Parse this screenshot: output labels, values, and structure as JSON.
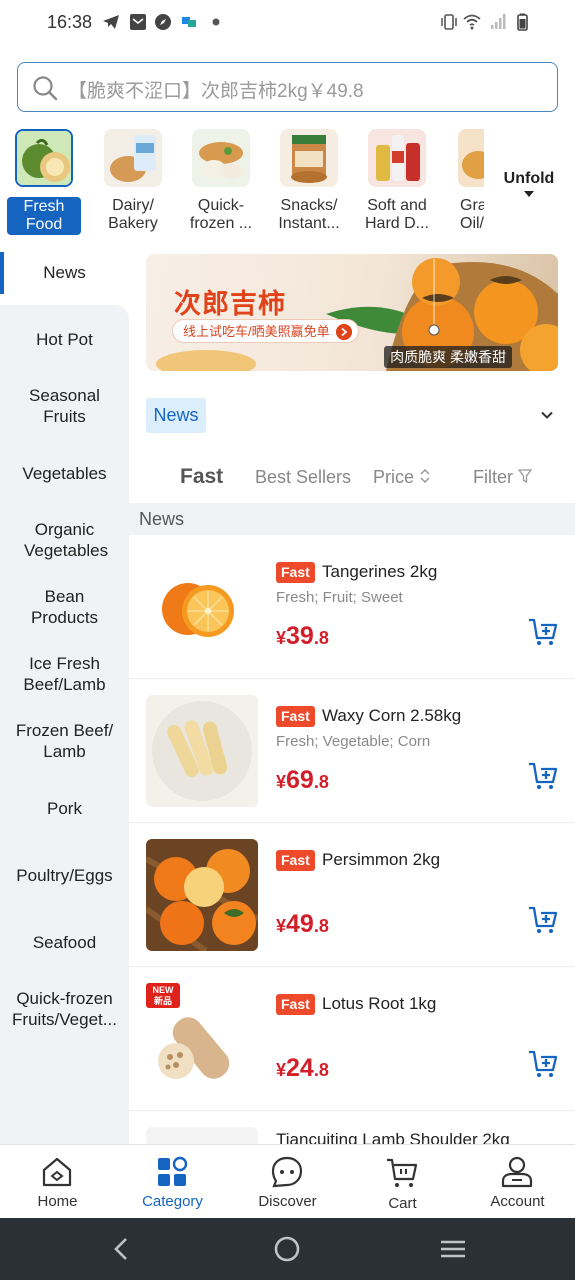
{
  "status_bar": {
    "time": "16:38",
    "icons": [
      "telegram-icon",
      "mail-icon",
      "compass-icon",
      "app-icon",
      "dot-icon",
      "vibrate-icon",
      "wifi-icon",
      "signal-icon",
      "battery-icon"
    ]
  },
  "search": {
    "placeholder": "【脆爽不涩口】次郎吉柿2kg￥49.8"
  },
  "categories": [
    {
      "label": "Fresh Food",
      "active": true
    },
    {
      "label": "Dairy/ Bakery",
      "active": false
    },
    {
      "label": "Quick- frozen ...",
      "active": false
    },
    {
      "label": "Snacks/ Instant...",
      "active": false
    },
    {
      "label": "Soft and Hard D...",
      "active": false
    },
    {
      "label": "Gra Oil/",
      "active": false
    }
  ],
  "unfold_label": "Unfold",
  "sidebar": {
    "items": [
      "News",
      "Hot Pot",
      "Seasonal Fruits",
      "Vegetables",
      "Organic Vegetables",
      "Bean Products",
      "Ice Fresh Beef/Lamb",
      "Frozen Beef/ Lamb",
      "Pork",
      "Poultry/Eggs",
      "Seafood",
      "Quick-frozen Fruits/Veget..."
    ],
    "active": "News"
  },
  "banner": {
    "title": "次郎吉柿",
    "pill": "线上试吃车/晒美照赢免单",
    "caption": "肉质脆爽 柔嫩香甜"
  },
  "filter_chip": "News",
  "sort_tabs": {
    "fast": "Fast",
    "best_sellers": "Best Sellers",
    "price": "Price",
    "filter": "Filter"
  },
  "section_title": "News",
  "products": [
    {
      "tag": "Fast",
      "name": "Tangerines 2kg",
      "desc": "Fresh; Fruit; Sweet",
      "yen": "¥",
      "price_int": "39",
      "price_dec": ".8"
    },
    {
      "tag": "Fast",
      "name": "Waxy Corn 2.58kg",
      "desc": "Fresh; Vegetable; Corn",
      "yen": "¥",
      "price_int": "69",
      "price_dec": ".8"
    },
    {
      "tag": "Fast",
      "name": "Persimmon 2kg",
      "desc": "",
      "yen": "¥",
      "price_int": "49",
      "price_dec": ".8"
    },
    {
      "tag": "Fast",
      "name": "Lotus Root 1kg",
      "desc": "",
      "yen": "¥",
      "price_int": "24",
      "price_dec": ".8",
      "badge": "NEW 新品"
    }
  ],
  "partial_product": "Tiancuiting Lamb Shoulder 2kg",
  "bottom_nav": [
    {
      "label": "Home",
      "icon": "home-icon",
      "active": false
    },
    {
      "label": "Category",
      "icon": "category-icon",
      "active": true
    },
    {
      "label": "Discover",
      "icon": "discover-icon",
      "active": false
    },
    {
      "label": "Cart",
      "icon": "cart-icon",
      "active": false
    },
    {
      "label": "Account",
      "icon": "account-icon",
      "active": false
    }
  ],
  "colors": {
    "accent": "#1565c0",
    "price": "#d21f2a",
    "fast_tag": "#ec4a2a",
    "sidebar_bg": "#f0f2f5"
  }
}
